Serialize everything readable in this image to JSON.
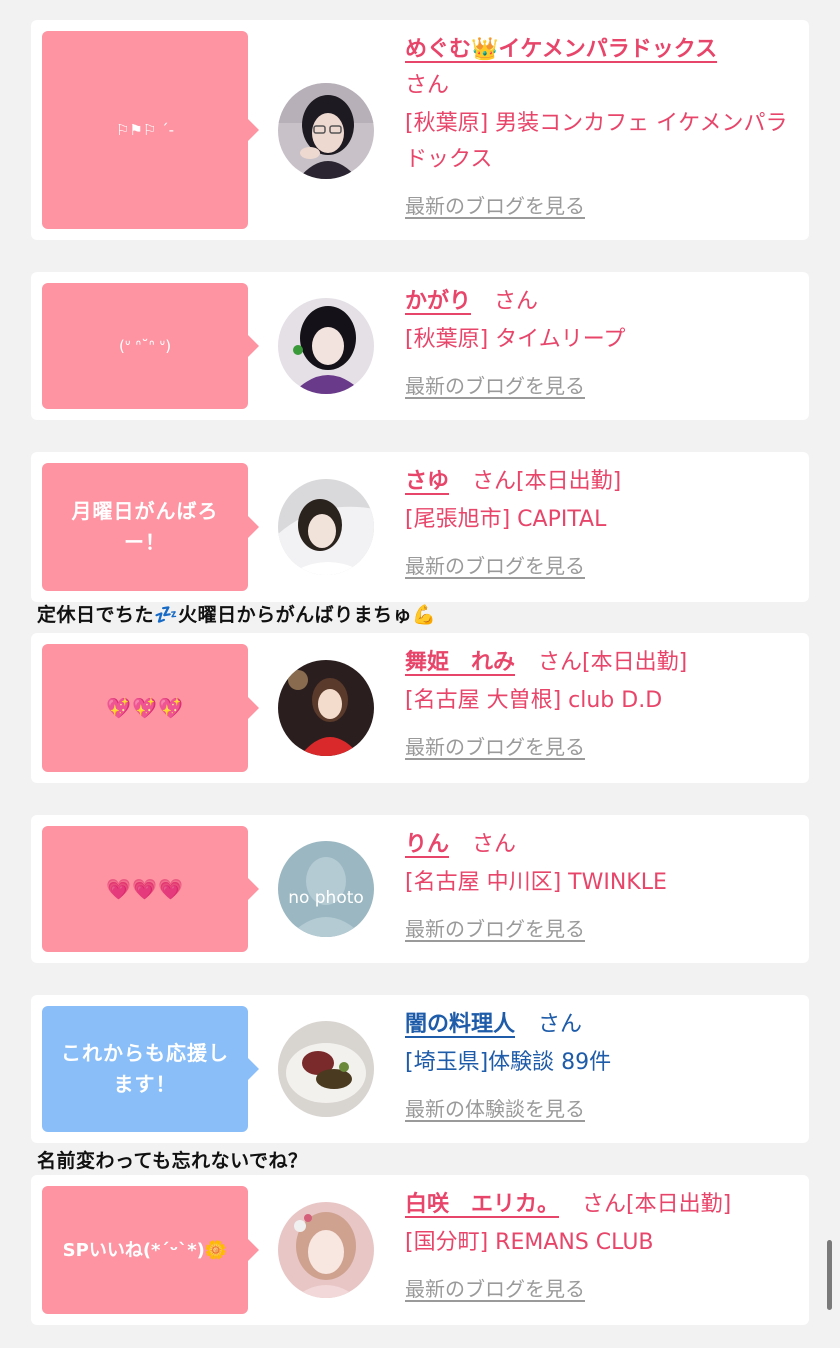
{
  "entries": [
    {
      "bubble": "⚐⚑⚐ ˊ-",
      "name": "めぐむ👑イケメンパラドックス",
      "san": "さん",
      "tag": "",
      "shop": "[秋葉原] 男装コンカフェ イケメンパラドックス",
      "link": "最新のブログを見る"
    },
    {
      "bubble": "(ᐡ ᐢ˘ᐢ ᐡ)",
      "name": "かがり",
      "san": "さん",
      "tag": "",
      "shop": "[秋葉原] タイムリープ",
      "link": "最新のブログを見る"
    },
    {
      "bubble": "月曜日がんばろー！",
      "name": "さゆ",
      "san": "さん",
      "tag": "[本日出勤]",
      "shop": "[尾張旭市] CAPITAL",
      "link": "最新のブログを見る",
      "caption": "定休日でちた💤火曜日からがんばりまちゅ💪"
    },
    {
      "bubble": "💖💖💖",
      "name": "舞姫　れみ",
      "san": "さん",
      "tag": "[本日出勤]",
      "shop": "[名古屋 大曽根] club D.D",
      "link": "最新のブログを見る"
    },
    {
      "bubble": "💗💗💗",
      "name": "りん",
      "san": "さん",
      "tag": "",
      "shop": "[名古屋 中川区] TWINKLE",
      "link": "最新のブログを見る",
      "avatar_text": "no photo"
    },
    {
      "bubble": "これからも応援します！",
      "name": "闇の料理人",
      "san": "さん",
      "tag": "",
      "shop": "[埼玉県]体験談 89件",
      "link": "最新の体験談を見る",
      "caption": "名前変わっても忘れないでね？"
    },
    {
      "bubble": "SPいいね(*´ᵕ`*)🌼",
      "name": "白咲　エリカ。",
      "san": "さん",
      "tag": "[本日出勤]",
      "shop": "[国分町] REMANS CLUB",
      "link": "最新のブログを見る"
    }
  ],
  "colors": {
    "pink_accent": "#e8456a",
    "bubble_pink": "#fe93a1",
    "bubble_blue": "#8abef8",
    "blue_accent": "#1e5ba8",
    "link_gray": "#9a9a9a"
  }
}
